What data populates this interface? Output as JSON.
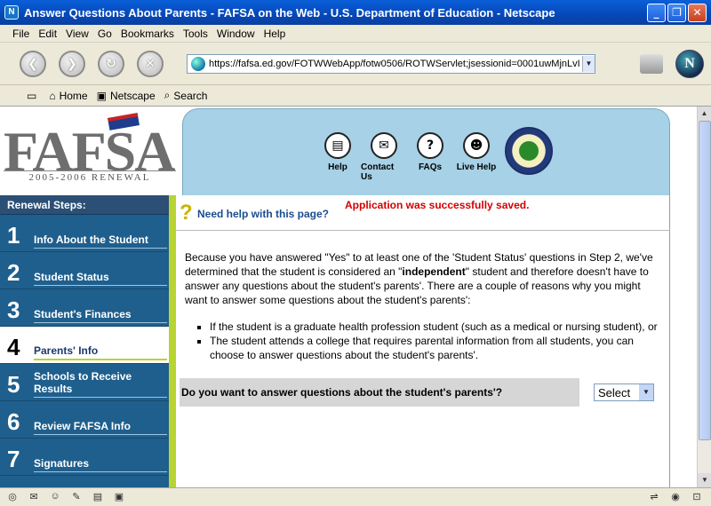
{
  "window": {
    "title": "Answer Questions About Parents - FAFSA on the Web - U.S. Department of Education - Netscape",
    "app_icon": "N",
    "minimize": "_",
    "maximize": "❐",
    "close": "✕"
  },
  "menu": [
    "File",
    "Edit",
    "View",
    "Go",
    "Bookmarks",
    "Tools",
    "Window",
    "Help"
  ],
  "navbar": {
    "url": "https://fafsa.ed.gov/FOTWWebApp/fotw0506/ROTWServlet;jsessionid=0001uwMjnLvI",
    "back_icon": "❮",
    "forward_icon": "❯",
    "reload_icon": "↻",
    "stop_icon": "✕",
    "logo_letter": "N"
  },
  "personal_toolbar": {
    "home": "Home",
    "netscape": "Netscape",
    "search": "Search"
  },
  "logo": {
    "wordmark": "FAFSA",
    "subtitle": "2005-2006 RENEWAL"
  },
  "top_nav": {
    "help": "Help",
    "contact": "Contact Us",
    "faqs": "FAQs",
    "live_help": "Live Help"
  },
  "sidebar": {
    "title": "Renewal Steps:",
    "steps": [
      {
        "num": "1",
        "label": "Info About the Student"
      },
      {
        "num": "2",
        "label": "Student Status"
      },
      {
        "num": "3",
        "label": "Student's Finances"
      },
      {
        "num": "4",
        "label": "Parents' Info"
      },
      {
        "num": "5",
        "label": "Schools to Receive Results"
      },
      {
        "num": "6",
        "label": "Review FAFSA Info"
      },
      {
        "num": "7",
        "label": "Signatures"
      }
    ]
  },
  "content": {
    "help_link": "Need help with this page?",
    "saved_message": "Application was successfully saved.",
    "intro_before": "Because you have answered \"Yes\" to at least one of the 'Student Status' questions in Step 2, we've determined that the student is considered an \"",
    "intro_bold": "independent",
    "intro_after": "\" student and therefore doesn't have to answer any questions about the student's parents'. There are a couple of reasons why you might want to answer some questions about the student's parents':",
    "bullets": [
      "If the student is a graduate health profession student (such as a medical or nursing student), or",
      "The student attends a college that requires parental information from all students, you can choose to answer questions about the student's parents'."
    ],
    "question": "Do you want to answer questions about the student's parents'?",
    "select_value": "Select"
  }
}
